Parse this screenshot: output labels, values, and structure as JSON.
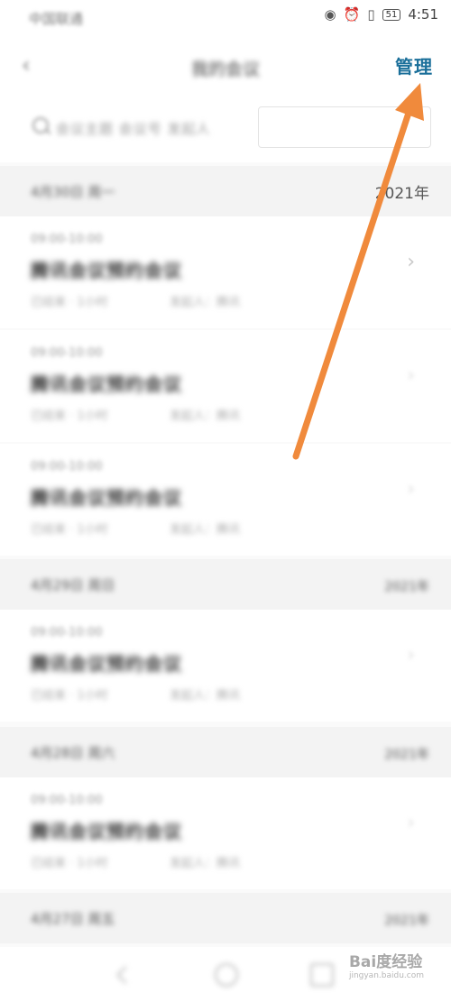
{
  "status_bar": {
    "carrier": "中国联通",
    "time": "4:51",
    "battery": "51",
    "icons": [
      "eye-icon",
      "alarm-icon",
      "vibrate-icon",
      "battery-icon"
    ]
  },
  "nav": {
    "back_icon": "chevron-left-icon",
    "title": "我的会议",
    "manage_label": "管理"
  },
  "search": {
    "placeholder": "会议主题  会议号  发起人"
  },
  "groups": [
    {
      "date": "4月30日 周一",
      "year": "2021年",
      "items": [
        {
          "time": "09:00-10:00",
          "title": "腾讯会议预约会议",
          "meta1": "已结束 · 1小时",
          "meta2": "发起人：腾讯"
        },
        {
          "time": "09:00-10:00",
          "title": "腾讯会议预约会议",
          "meta1": "已结束 · 1小时",
          "meta2": "发起人：腾讯"
        },
        {
          "time": "09:00-10:00",
          "title": "腾讯会议预约会议",
          "meta1": "已结束 · 1小时",
          "meta2": "发起人：腾讯"
        }
      ]
    },
    {
      "date": "4月29日 周日",
      "year": "2021年",
      "items": [
        {
          "time": "09:00-10:00",
          "title": "腾讯会议预约会议",
          "meta1": "已结束 · 1小时",
          "meta2": "发起人：腾讯"
        }
      ]
    },
    {
      "date": "4月28日 周六",
      "year": "2021年",
      "items": [
        {
          "time": "09:00-10:00",
          "title": "腾讯会议预约会议",
          "meta1": "已结束 · 1小时",
          "meta2": "发起人：腾讯"
        }
      ]
    },
    {
      "date": "4月27日 周五",
      "year": "2021年",
      "items": []
    }
  ],
  "watermark": {
    "brand": "Bai度经验",
    "url": "jingyan.baidu.com"
  },
  "colors": {
    "manage_accent": "#1a6f9a",
    "arrow": "#f08a3c"
  }
}
